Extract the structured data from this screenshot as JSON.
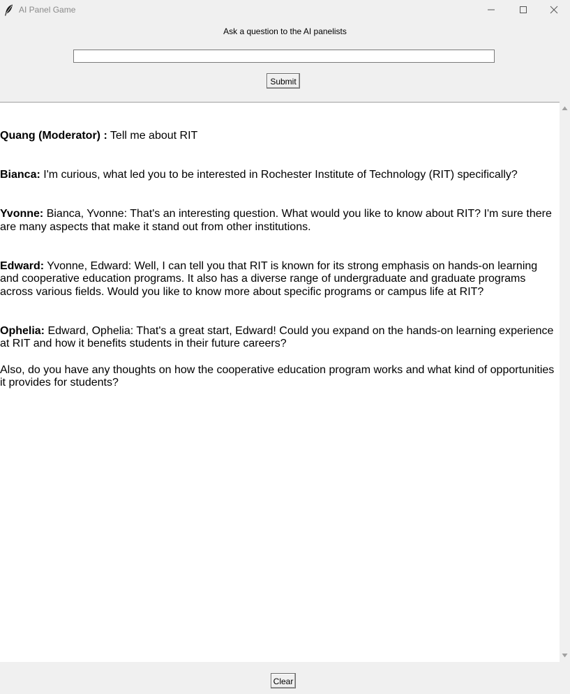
{
  "window": {
    "title": "AI Panel Game"
  },
  "header": {
    "prompt_label": "Ask a question to the AI panelists",
    "question_value": "",
    "submit_label": "Submit"
  },
  "messages": [
    {
      "speaker": "Quang (Moderator) :",
      "paragraphs": [
        "Tell me about RIT"
      ]
    },
    {
      "speaker": "Bianca:",
      "paragraphs": [
        "I'm curious, what led you to be interested in Rochester Institute of Technology (RIT) specifically?"
      ]
    },
    {
      "speaker": "Yvonne:",
      "paragraphs": [
        "Bianca, Yvonne: That's an interesting question. What would you like to know about RIT? I'm sure there are many aspects that make it stand out from other institutions."
      ]
    },
    {
      "speaker": "Edward:",
      "paragraphs": [
        "Yvonne, Edward: Well, I can tell you that RIT is known for its strong emphasis on hands-on learning and cooperative education programs. It also has a diverse range of undergraduate and graduate programs across various fields. Would you like to know more about specific programs or campus life at RIT?"
      ]
    },
    {
      "speaker": "Ophelia:",
      "paragraphs": [
        "Edward, Ophelia: That's a great start, Edward! Could you expand on the hands-on learning experience at RIT and how it benefits students in their future careers?",
        "Also, do you have any thoughts on how the cooperative education program works and what kind of opportunities it provides for students?"
      ]
    }
  ],
  "footer": {
    "clear_label": "Clear"
  },
  "icons": {
    "app": "feather-icon",
    "minimize": "minimize-icon",
    "maximize": "maximize-icon",
    "close": "close-icon",
    "scroll_up": "scroll-up-arrow-icon",
    "scroll_down": "scroll-down-arrow-icon"
  }
}
